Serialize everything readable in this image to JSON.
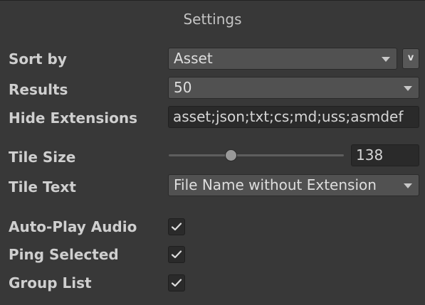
{
  "panel": {
    "title": "Settings"
  },
  "sort_by": {
    "label": "Sort by",
    "value": "Asset",
    "order_button_label": "v"
  },
  "results": {
    "label": "Results",
    "value": "50"
  },
  "hide_extensions": {
    "label": "Hide Extensions",
    "value": "asset;json;txt;cs;md;uss;asmdef"
  },
  "tile_size": {
    "label": "Tile Size",
    "value": "138"
  },
  "tile_text": {
    "label": "Tile Text",
    "value": "File Name without Extension"
  },
  "auto_play_audio": {
    "label": "Auto-Play Audio",
    "checked": true
  },
  "ping_selected": {
    "label": "Ping Selected",
    "checked": true
  },
  "group_list": {
    "label": "Group List",
    "checked": true
  },
  "colors": {
    "background": "#383838",
    "dropdown": "#515151",
    "field": "#2a2a2a",
    "text": "#d2d2d2"
  },
  "icons": {
    "dropdown_arrow": "chevron-down-icon",
    "check": "checkmark-icon"
  }
}
